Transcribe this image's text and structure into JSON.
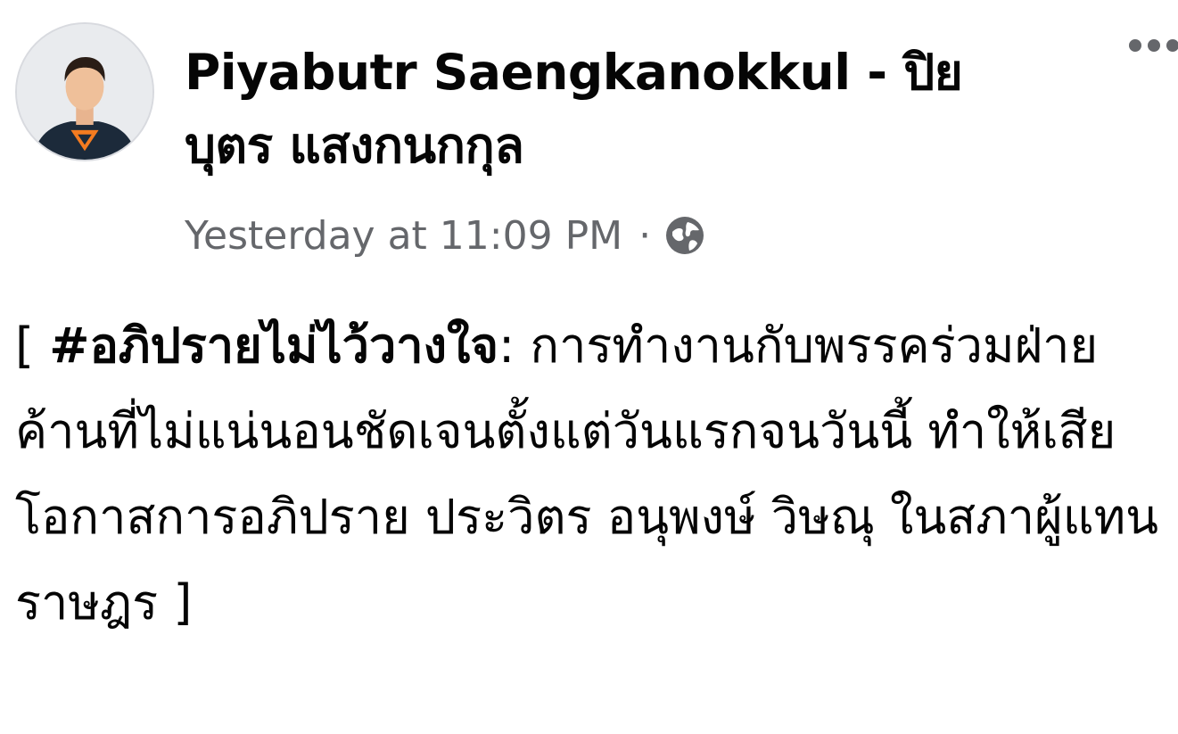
{
  "post": {
    "author_name": "Piyabutr Saengkanokkul - ปิยบุตร แสงกนกกุล",
    "timestamp": "Yesterday at 11:09 PM",
    "separator": "·",
    "privacy_icon": "globe-icon",
    "more_icon": "more-options-icon",
    "avatar_icon": "profile-avatar",
    "text_prefix": "[ ",
    "hashtag": "#อภิปรายไม่ไว้วางใจ",
    "text_body": ": การทำงานกับพรรคร่วมฝ่ายค้านที่ไม่แน่นอนชัดเจนตั้งแต่วันแรกจนวันนี้ ทำให้เสียโอกาสการอภิปราย ประวิตร อนุพงษ์ วิษณุ ในสภาผู้แทนราษฎร ]"
  },
  "colors": {
    "text_primary": "#050505",
    "text_secondary": "#65676b",
    "avatar_bg": "#e9ebee",
    "shirt": "#1c2a3a",
    "logo_orange": "#f47b20"
  }
}
